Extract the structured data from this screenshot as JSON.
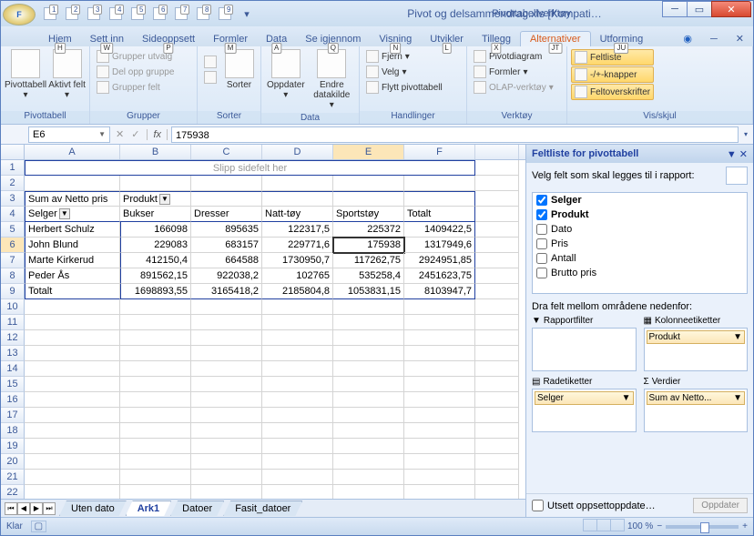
{
  "title": "Pivot og delsammendrag.xls  [Kompati…",
  "tooltab": "Pivottabellverktøy",
  "qat": [
    "1",
    "2",
    "3",
    "4",
    "5",
    "6",
    "7",
    "8",
    "9"
  ],
  "tabs": [
    {
      "label": "Hjem",
      "key": "H"
    },
    {
      "label": "Sett inn",
      "key": "W"
    },
    {
      "label": "Sideoppsett",
      "key": "P"
    },
    {
      "label": "Formler",
      "key": "M"
    },
    {
      "label": "Data",
      "key": "A"
    },
    {
      "label": "Se igjennom",
      "key": "Q"
    },
    {
      "label": "Visning",
      "key": "N"
    },
    {
      "label": "Utvikler",
      "key": "L"
    },
    {
      "label": "Tillegg",
      "key": "X"
    },
    {
      "label": "Alternativer",
      "key": "JT",
      "active": true
    },
    {
      "label": "Utforming",
      "key": "JU"
    }
  ],
  "ribbon": {
    "group1": {
      "label": "Pivottabell",
      "btns": [
        "Pivottabell",
        "Aktivt felt"
      ]
    },
    "group2": {
      "label": "Grupper",
      "items": [
        "Grupper utvalg",
        "Del opp gruppe",
        "Grupper felt"
      ]
    },
    "group3": {
      "label": "Sorter",
      "btn": "Sorter"
    },
    "group4": {
      "label": "Data",
      "btns": [
        "Oppdater",
        "Endre datakilde"
      ]
    },
    "group5": {
      "label": "Handlinger",
      "items": [
        "Fjern",
        "Velg",
        "Flytt pivottabell"
      ]
    },
    "group6": {
      "label": "Verktøy",
      "items": [
        "Pivotdiagram",
        "Formler",
        "OLAP-verktøy"
      ]
    },
    "group7": {
      "label": "Vis/skjul",
      "items": [
        "Feltliste",
        "-/+-knapper",
        "Feltoverskrifter"
      ]
    }
  },
  "namebox": "E6",
  "formula": "175938",
  "columns": [
    "A",
    "B",
    "C",
    "D",
    "E",
    "F"
  ],
  "dropzone": "Slipp sidefelt her",
  "pivot": {
    "measure": "Sum av Netto pris",
    "colField": "Produkt",
    "rowField": "Selger",
    "cols": [
      "Bukser",
      "Dresser",
      "Natt-tøy",
      "Sportstøy",
      "Totalt"
    ],
    "rows": [
      {
        "name": "Herbert Schulz",
        "v": [
          "166098",
          "895635",
          "122317,5",
          "225372",
          "1409422,5"
        ]
      },
      {
        "name": "John Blund",
        "v": [
          "229083",
          "683157",
          "229771,6",
          "175938",
          "1317949,6"
        ]
      },
      {
        "name": "Marte Kirkerud",
        "v": [
          "412150,4",
          "664588",
          "1730950,7",
          "117262,75",
          "2924951,85"
        ]
      },
      {
        "name": "Peder Ås",
        "v": [
          "891562,15",
          "922038,2",
          "102765",
          "535258,4",
          "2451623,75"
        ]
      },
      {
        "name": "Totalt",
        "v": [
          "1698893,55",
          "3165418,2",
          "2185804,8",
          "1053831,15",
          "8103947,7"
        ]
      }
    ]
  },
  "sheets": [
    "Uten dato",
    "Ark1",
    "Datoer",
    "Fasit_datoer"
  ],
  "activeSheet": "Ark1",
  "fieldpane": {
    "title": "Feltliste for pivottabell",
    "instr": "Velg felt som skal legges til i rapport:",
    "fields": [
      {
        "name": "Selger",
        "checked": true
      },
      {
        "name": "Produkt",
        "checked": true
      },
      {
        "name": "Dato",
        "checked": false
      },
      {
        "name": "Pris",
        "checked": false
      },
      {
        "name": "Antall",
        "checked": false
      },
      {
        "name": "Brutto pris",
        "checked": false
      }
    ],
    "dragInstr": "Dra felt mellom områdene nedenfor:",
    "areas": {
      "filter": {
        "label": "Rapportfilter",
        "items": []
      },
      "cols": {
        "label": "Kolonneetiketter",
        "items": [
          "Produkt"
        ]
      },
      "rows": {
        "label": "Radetiketter",
        "items": [
          "Selger"
        ]
      },
      "vals": {
        "label": "Verdier",
        "items": [
          "Sum av Netto..."
        ]
      }
    },
    "defer": "Utsett oppsettoppdate…",
    "update": "Oppdater"
  },
  "status": {
    "ready": "Klar",
    "zoom": "100 %"
  }
}
